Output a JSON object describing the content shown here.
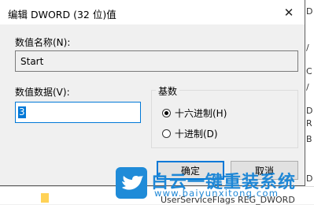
{
  "dialog": {
    "title": "编辑 DWORD (32 位)值",
    "value_name_label": "数值名称(N):",
    "value_name": "Start",
    "value_data_label": "数值数据(V):",
    "value_data": "3",
    "base": {
      "title": "基数",
      "options": [
        {
          "label": "十六进制(H)",
          "checked": true
        },
        {
          "label": "十进制(D)",
          "checked": false
        }
      ]
    },
    "ok_label": "确定",
    "cancel_label": "取消"
  },
  "background": {
    "right_fragments": [
      "D",
      "/",
      "C",
      "/",
      "D",
      "R",
      "B",
      "D"
    ],
    "bottom_fragment": "UserServiceFlags  REG_DWORD"
  },
  "watermark": {
    "title": "白云一键重装系统",
    "url": "www.baiyunxitong.com"
  },
  "colors": {
    "accent": "#0078d7",
    "watermark": "#1e87d6"
  }
}
